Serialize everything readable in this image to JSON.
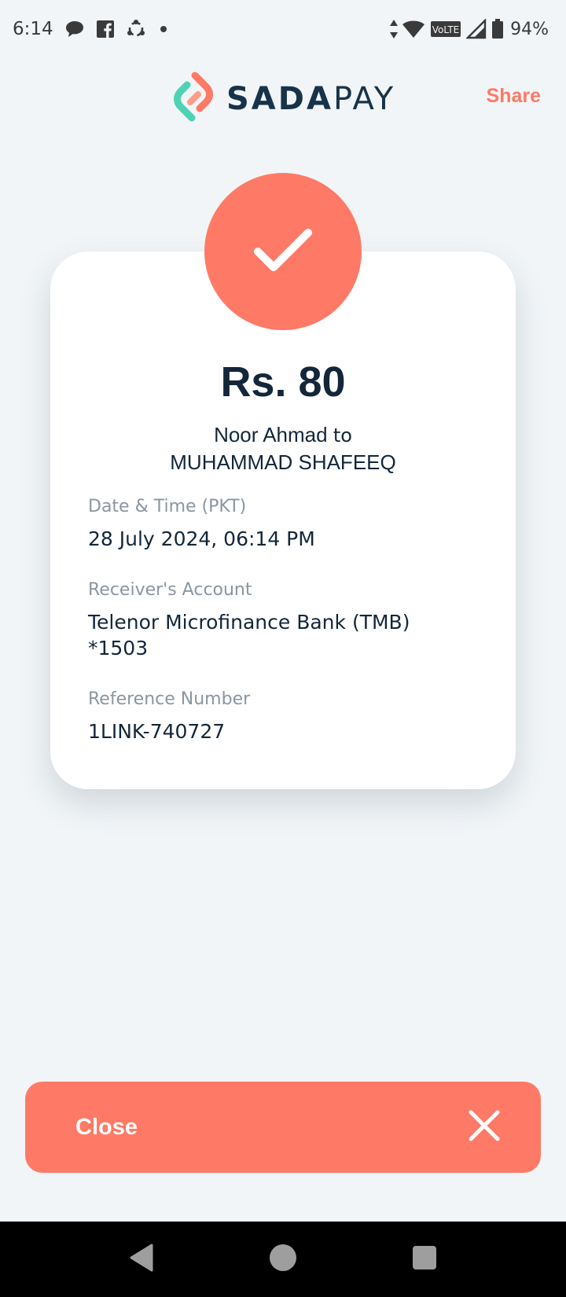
{
  "status_bar": {
    "time": "6:14",
    "battery": "94%",
    "network_label": "VoLTE",
    "icons": [
      "chat-bubble-icon",
      "facebook-icon",
      "sync-icon",
      "dot-icon",
      "data-arrows-icon",
      "wifi-icon",
      "volte-icon",
      "signal-icon",
      "battery-icon"
    ]
  },
  "header": {
    "logo_bold": "SADA",
    "logo_light": "PAY",
    "share_label": "Share"
  },
  "receipt": {
    "amount": "Rs. 80",
    "sender": "Noor Ahmad",
    "connector": "to",
    "receiver": "MUHAMMAD SHAFEEQ",
    "details": [
      {
        "label": "Date & Time (PKT)",
        "value": "28 July 2024, 06:14 PM"
      },
      {
        "label": "Receiver's Account",
        "value_line1": "Telenor Microfinance Bank (TMB)",
        "value_line2": "*1503"
      },
      {
        "label": "Reference Number",
        "value": "1LINK-740727"
      }
    ]
  },
  "footer": {
    "close_label": "Close"
  },
  "colors": {
    "accent": "#ff7a66",
    "background": "#f1f5f7",
    "text_primary": "#13263a",
    "text_muted": "#8a96a3",
    "logo_teal": "#4fd1b5"
  }
}
